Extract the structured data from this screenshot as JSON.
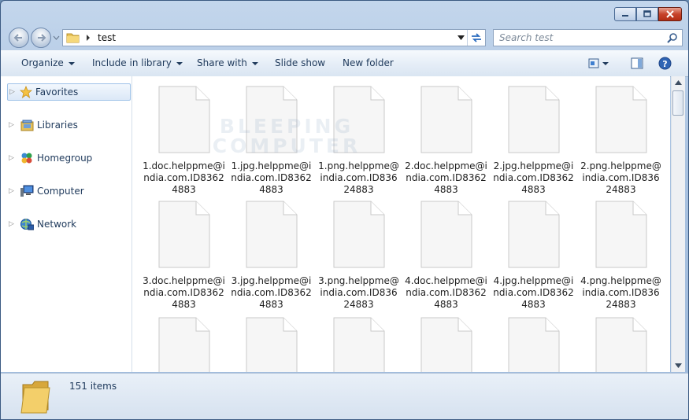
{
  "window": {
    "controls": [
      "minimize-icon",
      "maximize-icon",
      "close-icon"
    ]
  },
  "address": {
    "path": "test",
    "search_placeholder": "Search test"
  },
  "toolbar": {
    "organize": "Organize",
    "include_in_library": "Include in library",
    "share_with": "Share with",
    "slide_show": "Slide show",
    "new_folder": "New folder"
  },
  "nav": {
    "items": [
      {
        "label": "Favorites",
        "icon": "star-icon"
      },
      {
        "label": "Libraries",
        "icon": "libraries-icon"
      },
      {
        "label": "Homegroup",
        "icon": "homegroup-icon"
      },
      {
        "label": "Computer",
        "icon": "computer-icon"
      },
      {
        "label": "Network",
        "icon": "network-icon"
      }
    ]
  },
  "files": [
    {
      "name": "1.doc.helppme@india.com.ID83624883"
    },
    {
      "name": "1.jpg.helppme@india.com.ID83624883"
    },
    {
      "name": "1.png.helppme@india.com.ID83624883"
    },
    {
      "name": "2.doc.helppme@india.com.ID83624883"
    },
    {
      "name": "2.jpg.helppme@india.com.ID83624883"
    },
    {
      "name": "2.png.helppme@india.com.ID83624883"
    },
    {
      "name": "3.doc.helppme@india.com.ID83624883"
    },
    {
      "name": "3.jpg.helppme@india.com.ID83624883"
    },
    {
      "name": "3.png.helppme@india.com.ID83624883"
    },
    {
      "name": "4.doc.helppme@india.com.ID83624883"
    },
    {
      "name": "4.jpg.helppme@india.com.ID83624883"
    },
    {
      "name": "4.png.helppme@india.com.ID83624883"
    },
    {
      "name": ""
    },
    {
      "name": ""
    },
    {
      "name": ""
    },
    {
      "name": ""
    },
    {
      "name": ""
    },
    {
      "name": ""
    }
  ],
  "watermark": {
    "line1": "BLEEPING",
    "line2": "COMPUTER"
  },
  "status": {
    "count": "151 items"
  }
}
